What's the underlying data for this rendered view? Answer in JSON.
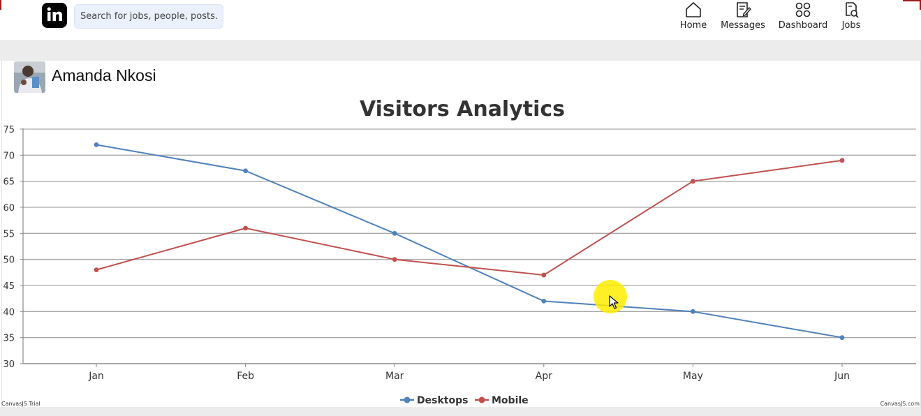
{
  "app": {
    "search_placeholder": "Search for jobs, people, posts..",
    "nav": [
      {
        "label": "Home",
        "icon": "home-icon"
      },
      {
        "label": "Messages",
        "icon": "messages-icon"
      },
      {
        "label": "Dashboard",
        "icon": "dashboard-icon"
      },
      {
        "label": "Jobs",
        "icon": "jobs-icon"
      }
    ]
  },
  "profile": {
    "name": "Amanda Nkosi"
  },
  "footer": {
    "trial_text": "CanvasJS Trial",
    "credit_text": "CanvasJS.com"
  },
  "colors": {
    "desktops": "#4f81bc",
    "mobile": "#c0504e",
    "grid": "#a8a8a8",
    "highlight": "#ffec00"
  },
  "chart_data": {
    "type": "line",
    "title": "Visitors Analytics",
    "categories": [
      "Jan",
      "Feb",
      "Mar",
      "Apr",
      "May",
      "Jun"
    ],
    "y_ticks": [
      "30",
      "35",
      "40",
      "45",
      "50",
      "55",
      "60",
      "65",
      "70",
      "75"
    ],
    "ylim": [
      30,
      75
    ],
    "grid": true,
    "legend_position": "bottom",
    "series": [
      {
        "name": "Desktops",
        "color": "#4f81bc",
        "values": [
          72,
          67,
          55,
          42,
          40,
          35
        ]
      },
      {
        "name": "Mobile",
        "color": "#c0504e",
        "values": [
          48,
          56,
          50,
          47,
          65,
          69
        ]
      }
    ]
  }
}
